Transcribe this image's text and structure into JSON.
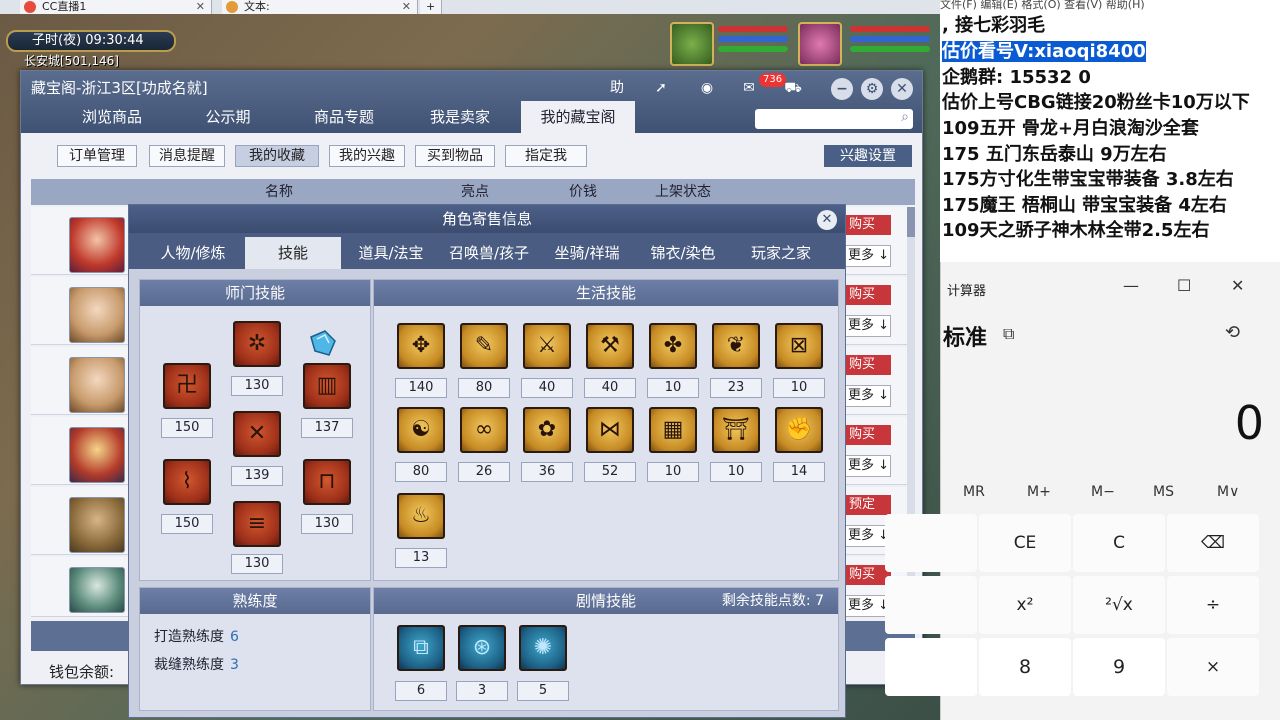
{
  "browser": {
    "tabs": [
      {
        "label": "CC直播1"
      },
      {
        "label": "文本:"
      }
    ]
  },
  "game": {
    "time": "子时(夜)  09:30:44",
    "location": "长安城[501,146]"
  },
  "cbg": {
    "title": "藏宝阁-浙江3区[功成名就]",
    "header_buttons": {
      "help": "助",
      "badge": "736"
    },
    "nav_tabs": [
      "浏览商品",
      "公示期",
      "商品专题",
      "我是卖家",
      "我的藏宝阁"
    ],
    "sub_buttons": [
      "订单管理",
      "消息提醒",
      "我的收藏",
      "我的兴趣",
      "买到物品",
      "指定我"
    ],
    "interest_button": "兴趣设置",
    "columns": {
      "name": "名称",
      "highlight": "亮点",
      "price": "价钱",
      "status": "上架状态"
    },
    "row_actions": {
      "buy": [
        "购买",
        "购买",
        "购买",
        "购买",
        "预定",
        "购买"
      ],
      "more": "更多 ↓"
    },
    "wallet_label": "钱包余额:"
  },
  "popup": {
    "title": "角色寄售信息",
    "tabs": [
      "人物/修炼",
      "技能",
      "道具/法宝",
      "召唤兽/孩子",
      "坐骑/祥瑞",
      "锦衣/染色",
      "玩家之家"
    ],
    "sect_skills": {
      "title": "师门技能",
      "levels": [
        "150",
        "130",
        "137",
        "139",
        "150",
        "130",
        "130"
      ]
    },
    "life_skills": {
      "title": "生活技能",
      "levels": [
        "140",
        "80",
        "40",
        "40",
        "10",
        "23",
        "10",
        "80",
        "26",
        "36",
        "52",
        "10",
        "10",
        "14",
        "13"
      ]
    },
    "proficiency": {
      "title": "熟练度",
      "forge_label": "打造熟练度",
      "forge_value": "6",
      "tailor_label": "裁缝熟练度",
      "tailor_value": "3"
    },
    "story_skills": {
      "title": "剧情技能",
      "remaining_label": "剩余技能点数:",
      "remaining_value": "7",
      "levels": [
        "6",
        "3",
        "5"
      ]
    }
  },
  "notepad": {
    "menu": "文件(F)     编辑(E)     格式(O)     查看(V)     帮助(H)",
    "lines": [
      ",      接七彩羽毛",
      "估价看号V:xiaoqi8400",
      "企鹅群: 15532 0",
      "估价上号CBG链接20粉丝卡10万以下",
      "109五开 骨龙+月白浪淘沙全套",
      "175 五门东岳泰山  9万左右",
      "175方寸化生带宝宝带装备  3.8左右",
      "175魔王 梧桐山  带宝宝装备 4左右",
      "109天之骄子神木林全带2.5左右"
    ]
  },
  "calculator": {
    "title": "计算器",
    "mode": "标准",
    "display": "0",
    "memory": [
      "MR",
      "M+",
      "M−",
      "MS",
      "M∨"
    ],
    "keys": [
      "CE",
      "C",
      "⌫",
      "x²",
      "²√x",
      "÷",
      "8",
      "9",
      "×"
    ]
  },
  "colors": {
    "cbg_header": "#3f5274",
    "buy_red": "#c6363a",
    "selection_blue": "#0a5bd3"
  }
}
